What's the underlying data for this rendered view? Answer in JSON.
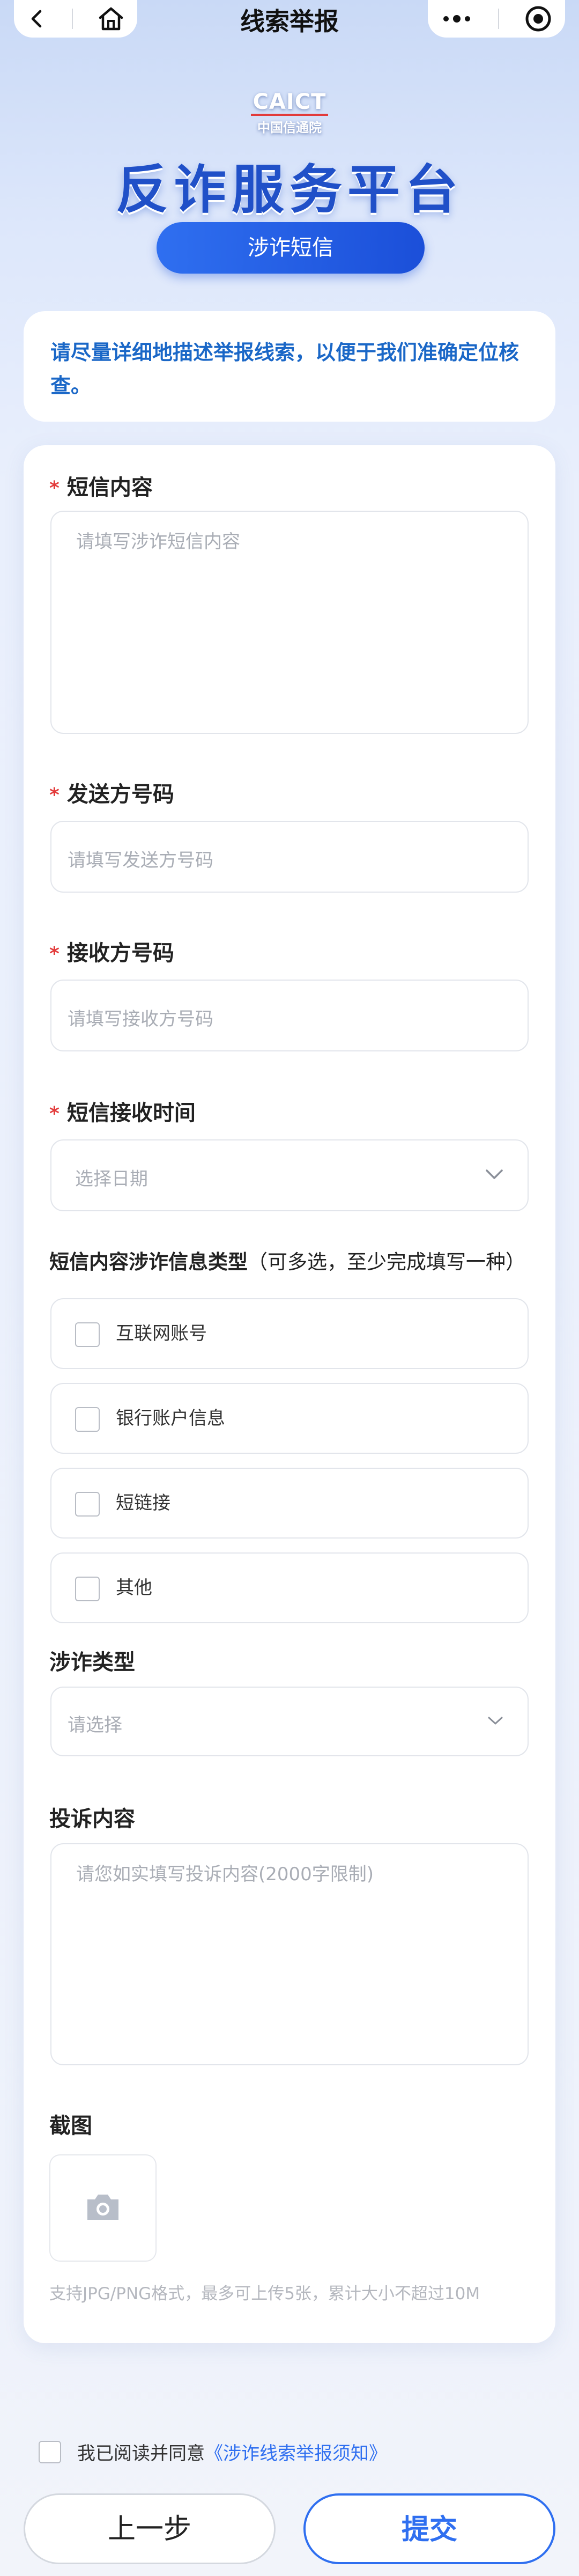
{
  "nav": {
    "title": "线索举报",
    "back_icon": "chevron-left-icon",
    "home_icon": "home-icon",
    "more_icon": "more-dots-icon",
    "target_icon": "target-icon"
  },
  "header": {
    "logo_en": "CAICT",
    "logo_cn": "中国信通院",
    "title": "反诈服务平台",
    "category": "涉诈短信"
  },
  "notice": "请尽量详细地描述举报线索，以便于我们准确定位核查。",
  "form": {
    "sms_content": {
      "label": "短信内容",
      "required": "*",
      "placeholder": "请填写涉诈短信内容"
    },
    "sender": {
      "label": "发送方号码",
      "required": "*",
      "placeholder": "请填写发送方号码"
    },
    "receiver": {
      "label": "接收方号码",
      "required": "*",
      "placeholder": "请填写接收方号码"
    },
    "receive_time": {
      "label": "短信接收时间",
      "required": "*",
      "placeholder": "选择日期"
    },
    "info_types": {
      "label_bold": "短信内容涉诈信息类型",
      "label_note": "（可多选，至少完成填写一种）",
      "options": [
        "互联网账号",
        "银行账户信息",
        "短链接",
        "其他"
      ]
    },
    "fraud_type": {
      "label": "涉诈类型",
      "placeholder": "请选择"
    },
    "complaint": {
      "label": "投诉内容",
      "placeholder": "请您如实填写投诉内容(2000字限制)"
    },
    "screenshot": {
      "label": "截图",
      "icon": "camera-icon",
      "hint": "支持JPG/PNG格式，最多可上传5张，累计大小不超过10M"
    }
  },
  "footer": {
    "agree_text": "我已阅读并同意",
    "agree_link": "《涉诈线索举报须知》",
    "prev_label": "上一步",
    "submit_label": "提交"
  },
  "colors": {
    "primary": "#2f6ff0",
    "title_blue": "#2050c8",
    "notice_blue": "#1a67c7",
    "required_red": "#e33b3b"
  }
}
